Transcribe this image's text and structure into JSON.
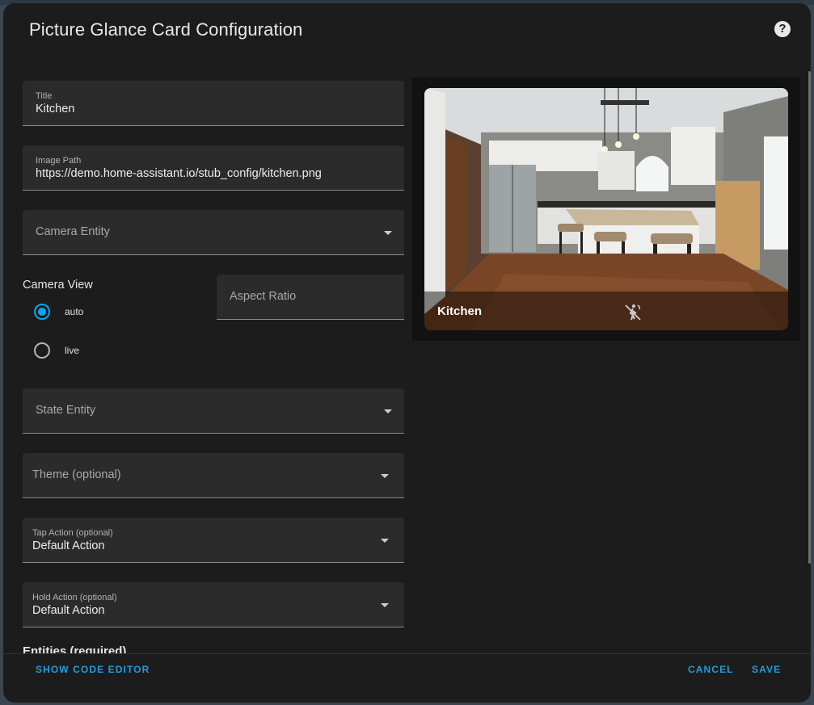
{
  "dialog": {
    "title": "Picture Glance Card Configuration",
    "help_icon": "help-circle-icon"
  },
  "form": {
    "title": {
      "label": "Title",
      "value": "Kitchen"
    },
    "image_path": {
      "label": "Image Path",
      "value": "https://demo.home-assistant.io/stub_config/kitchen.png"
    },
    "camera_entity": {
      "placeholder": "Camera Entity"
    },
    "camera_view": {
      "label": "Camera View",
      "options": [
        {
          "label": "auto",
          "selected": true
        },
        {
          "label": "live",
          "selected": false
        }
      ]
    },
    "aspect_ratio": {
      "placeholder": "Aspect Ratio"
    },
    "state_entity": {
      "placeholder": "State Entity"
    },
    "theme": {
      "placeholder": "Theme (optional)"
    },
    "tap_action": {
      "label": "Tap Action (optional)",
      "value": "Default Action"
    },
    "hold_action": {
      "label": "Hold Action (optional)",
      "value": "Default Action"
    },
    "entities_heading": "Entities (required)"
  },
  "preview": {
    "card_title": "Kitchen",
    "icon": "motion-sensor-off-icon"
  },
  "footer": {
    "code_editor": "Show Code Editor",
    "cancel": "Cancel",
    "save": "Save"
  },
  "colors": {
    "accent": "#03a9f4",
    "button_text": "#1e9ee0",
    "dialog_bg": "#1c1c1c",
    "field_bg": "#2b2b2b"
  }
}
